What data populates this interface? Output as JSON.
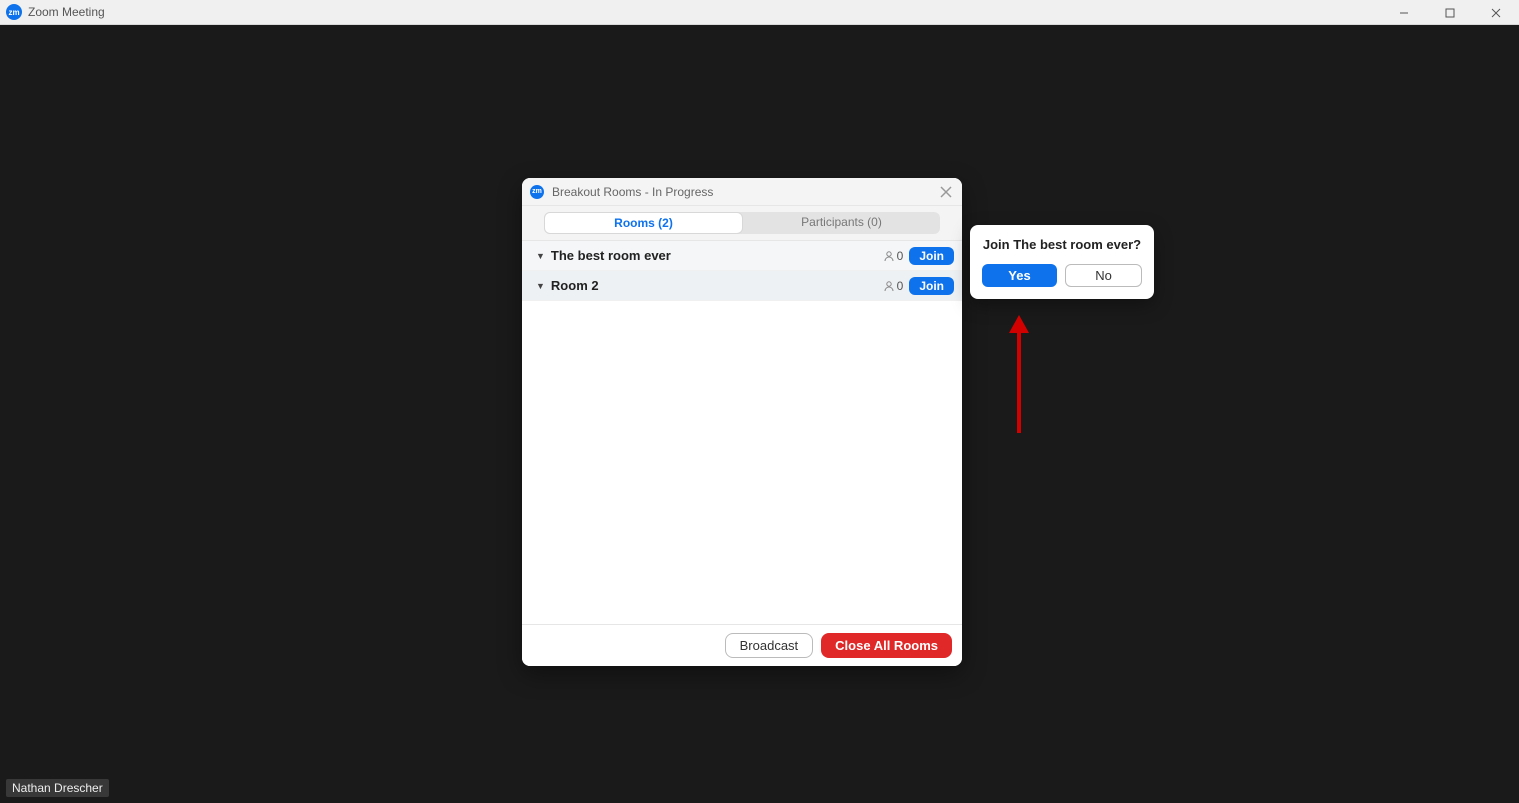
{
  "window": {
    "title": "Zoom Meeting"
  },
  "participant_label": "Nathan Drescher",
  "dialog": {
    "title": "Breakout Rooms - In Progress",
    "tabs": {
      "rooms": "Rooms (2)",
      "participants": "Participants (0)"
    },
    "rooms": [
      {
        "name": "The best room ever",
        "count": "0",
        "join": "Join"
      },
      {
        "name": "Room 2",
        "count": "0",
        "join": "Join"
      }
    ],
    "footer": {
      "broadcast": "Broadcast",
      "close_all": "Close All Rooms"
    }
  },
  "popover": {
    "title": "Join The best room ever?",
    "yes": "Yes",
    "no": "No"
  }
}
